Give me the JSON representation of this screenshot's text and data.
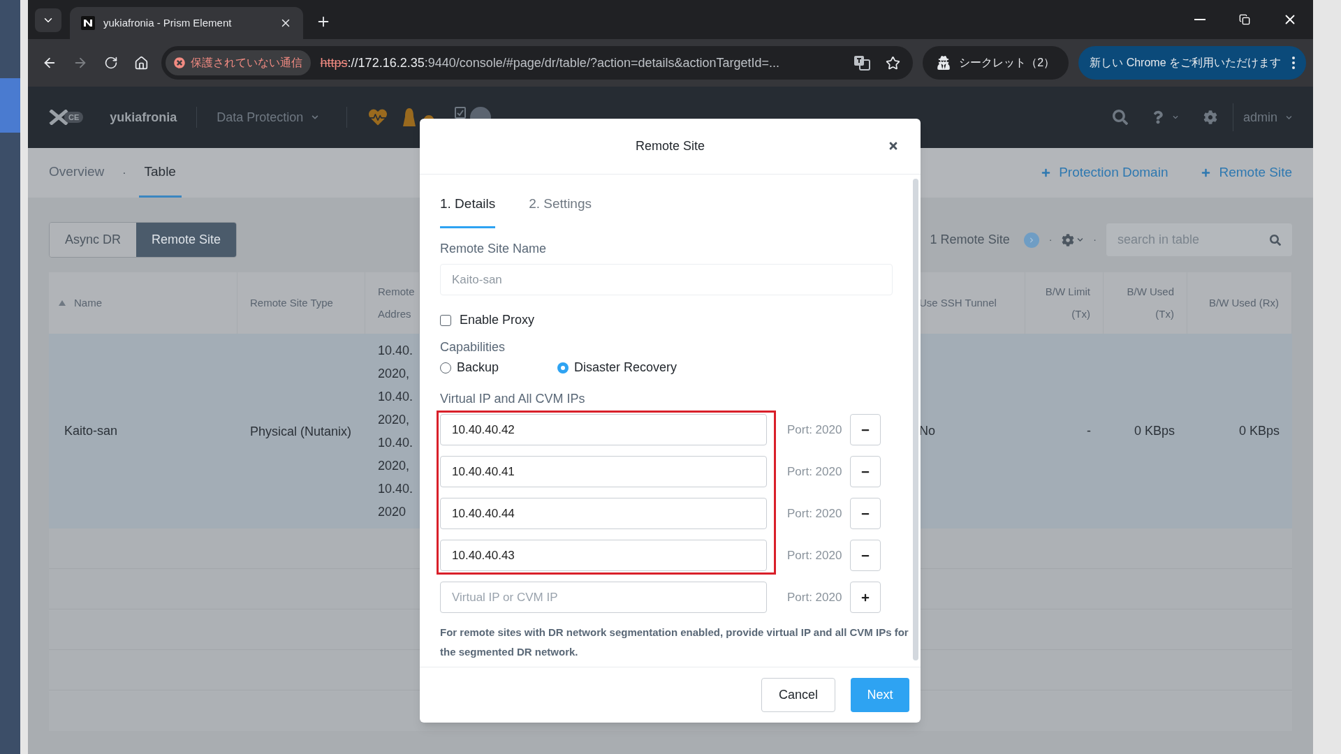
{
  "browser": {
    "tabs": [
      {
        "title": "yukiafronia - Prism Element",
        "selected": true
      }
    ],
    "forward": {
      "disabled": true
    },
    "security_chip": "保護されていない通信",
    "url": {
      "scheme": "https",
      "host": "://172.16.2.35",
      "path": ":9440/console/#page/dr/table/?action=details&actionTargetId=..."
    },
    "incognito": "シークレット（2）",
    "update_chip": "新しい Chrome をご利用いただけます"
  },
  "app_header": {
    "logo_badge": "CE",
    "cluster": "yukiafronia",
    "section": "Data Protection",
    "user": "admin"
  },
  "page_tabs": [
    {
      "label": "Overview",
      "selected": false
    },
    {
      "label": "Table",
      "selected": true
    }
  ],
  "tab_separator": "·",
  "actions": [
    "Protection Domain",
    "Remote Site"
  ],
  "segments": [
    {
      "label": "Async DR",
      "selected": false
    },
    {
      "label": "Remote Site",
      "selected": true
    }
  ],
  "count": "1 Remote Site",
  "toolbar_separators": [
    "·",
    "·"
  ],
  "search": {
    "placeholder": "search in table"
  },
  "table": {
    "columns": [
      {
        "label": "Name",
        "sorted": true
      },
      {
        "label": "Remote Site Type",
        "sorted": false
      },
      {
        "label": "Remote Addres",
        "sorted": false
      },
      {
        "label": "Use SSH Tunnel",
        "sorted": false
      },
      {
        "label": "B/W Limit (Tx)",
        "sorted": false
      },
      {
        "label": "B/W Used (Tx)",
        "sorted": false
      },
      {
        "label": "B/W Used (Rx)",
        "sorted": false
      }
    ],
    "rows": [
      {
        "selected": true,
        "name": "Kaito-san",
        "type": "Physical (Nutanix)",
        "address_lines": [
          "10.40.",
          "2020,",
          "10.40.",
          "2020,",
          "10.40.",
          "2020,",
          "10.40.",
          "2020"
        ],
        "ssh_tunnel": "No",
        "bw_limit_tx": "-",
        "bw_used_tx": "0 KBps",
        "bw_used_rx": "0 KBps"
      }
    ]
  },
  "dialog": {
    "title": "Remote Site",
    "steps": [
      {
        "label": "1. Details",
        "selected": true
      },
      {
        "label": "2. Settings",
        "selected": false
      }
    ],
    "name_field": {
      "label": "Remote Site Name",
      "value": "Kaito-san",
      "disabled": true
    },
    "enable_proxy": {
      "label": "Enable Proxy",
      "checked": false
    },
    "capabilities": {
      "label": "Capabilities",
      "options": [
        {
          "label": "Backup",
          "selected": false
        },
        {
          "label": "Disaster Recovery",
          "selected": true
        }
      ]
    },
    "ips": {
      "label": "Virtual IP and All CVM IPs",
      "rows": [
        {
          "kind": "entry",
          "value": "10.40.40.42",
          "port": "Port: 2020",
          "highlighted": true
        },
        {
          "kind": "entry",
          "value": "10.40.40.41",
          "port": "Port: 2020",
          "highlighted": true
        },
        {
          "kind": "entry",
          "value": "10.40.40.44",
          "port": "Port: 2020",
          "highlighted": true
        },
        {
          "kind": "entry",
          "value": "10.40.40.43",
          "port": "Port: 2020",
          "highlighted": true
        },
        {
          "kind": "new",
          "placeholder": "Virtual IP or CVM IP",
          "port": "Port: 2020",
          "highlighted": false
        }
      ]
    },
    "hint": "For remote sites with DR network segmentation enabled, provide virtual IP and all CVM IPs for the segmented DR network.",
    "buttons": [
      {
        "label": "Cancel",
        "kind": "secondary"
      },
      {
        "label": "Next",
        "kind": "primary"
      }
    ]
  }
}
